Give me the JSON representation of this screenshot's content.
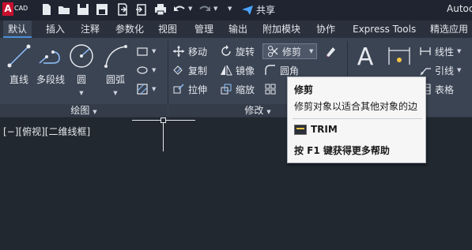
{
  "app": {
    "logo_letter": "A",
    "logo_badge": "CAD",
    "title": "Autoc",
    "share_label": "共享"
  },
  "tabs": [
    {
      "label": "默认",
      "active": true
    },
    {
      "label": "插入"
    },
    {
      "label": "注释"
    },
    {
      "label": "参数化"
    },
    {
      "label": "视图"
    },
    {
      "label": "管理"
    },
    {
      "label": "输出"
    },
    {
      "label": "附加模块"
    },
    {
      "label": "协作"
    },
    {
      "label": "Express Tools"
    },
    {
      "label": "精选应用"
    }
  ],
  "draw_panel": {
    "title": "绘图",
    "tools": [
      {
        "label": "直线",
        "icon": "line-icon"
      },
      {
        "label": "多段线",
        "icon": "polyline-icon"
      },
      {
        "label": "圆",
        "icon": "circle-icon"
      },
      {
        "label": "圆弧",
        "icon": "arc-icon"
      }
    ]
  },
  "modify_panel": {
    "title": "修改",
    "tools": [
      {
        "label": "移动",
        "icon": "move-icon"
      },
      {
        "label": "旋转",
        "icon": "rotate-icon"
      },
      {
        "label": "修剪",
        "icon": "trim-icon"
      },
      {
        "label": "复制",
        "icon": "copy-icon"
      },
      {
        "label": "镜像",
        "icon": "mirror-icon"
      },
      {
        "label": "圆角",
        "icon": "fillet-icon"
      },
      {
        "label": "拉伸",
        "icon": "stretch-icon"
      },
      {
        "label": "缩放",
        "icon": "scale-icon"
      }
    ]
  },
  "annotation_panel": {
    "tools": [
      {
        "label": "线性",
        "icon": "linear-dimension-icon"
      },
      {
        "label": "引线",
        "icon": "leader-icon"
      },
      {
        "label": "表格",
        "icon": "table-icon"
      }
    ]
  },
  "viewport": {
    "label": "[−][俯视][二维线框]"
  },
  "tooltip": {
    "title": "修剪",
    "description": "修剪对象以适合其他对象的边",
    "command": "TRIM",
    "help": "按 F1 键获得更多帮助"
  },
  "colors": {
    "ribbon_bg": "#3b4453",
    "workspace_bg": "#212830",
    "accent": "#4a90d9",
    "logo_red": "#c8102e"
  }
}
